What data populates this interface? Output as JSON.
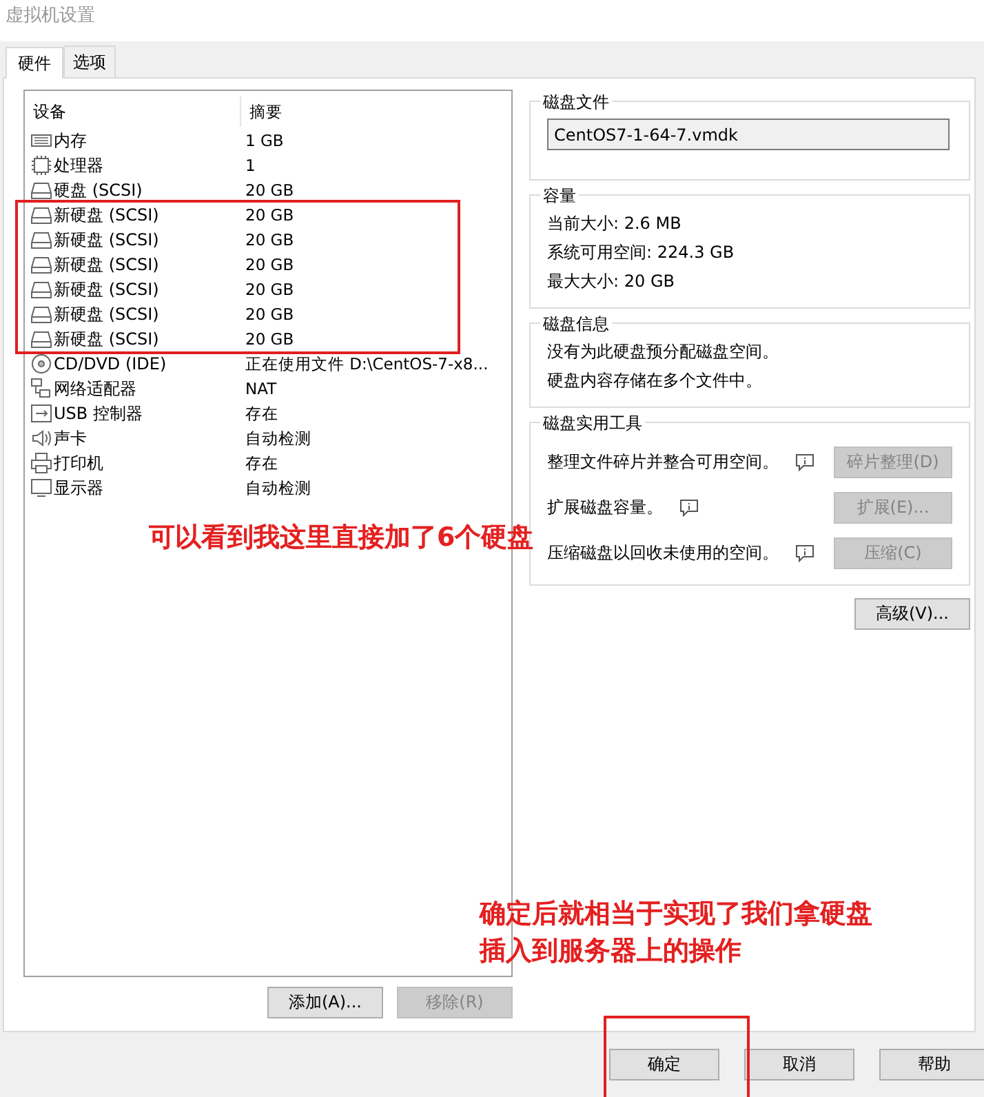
{
  "window": {
    "title": "虚拟机设置"
  },
  "tabs": [
    {
      "label": "硬件",
      "selected": true
    },
    {
      "label": "选项",
      "selected": false
    }
  ],
  "devices": {
    "columns": [
      "设备",
      "摘要"
    ],
    "rows": [
      {
        "kind": "memory",
        "name": "内存",
        "summary": "1 GB"
      },
      {
        "kind": "cpu",
        "name": "处理器",
        "summary": "1"
      },
      {
        "kind": "disk",
        "name": "硬盘 (SCSI)",
        "summary": "20 GB"
      },
      {
        "kind": "disk",
        "name": "新硬盘 (SCSI)",
        "summary": "20 GB"
      },
      {
        "kind": "disk",
        "name": "新硬盘 (SCSI)",
        "summary": "20 GB"
      },
      {
        "kind": "disk",
        "name": "新硬盘 (SCSI)",
        "summary": "20 GB"
      },
      {
        "kind": "disk",
        "name": "新硬盘 (SCSI)",
        "summary": "20 GB"
      },
      {
        "kind": "disk",
        "name": "新硬盘 (SCSI)",
        "summary": "20 GB"
      },
      {
        "kind": "disk",
        "name": "新硬盘 (SCSI)",
        "summary": "20 GB"
      },
      {
        "kind": "cdrom",
        "name": "CD/DVD (IDE)",
        "summary": "正在使用文件 D:\\CentOS-7-x8..."
      },
      {
        "kind": "network",
        "name": "网络适配器",
        "summary": "NAT"
      },
      {
        "kind": "usb",
        "name": "USB 控制器",
        "summary": "存在"
      },
      {
        "kind": "sound",
        "name": "声卡",
        "summary": "自动检测"
      },
      {
        "kind": "printer",
        "name": "打印机",
        "summary": "存在"
      },
      {
        "kind": "display",
        "name": "显示器",
        "summary": "自动检测"
      }
    ]
  },
  "list_buttons": [
    {
      "label": "添加(A)...",
      "disabled": false
    },
    {
      "label": "移除(R)",
      "disabled": true
    }
  ],
  "disk_file": {
    "title": "磁盘文件",
    "value": "CentOS7-1-64-7.vmdk"
  },
  "capacity": {
    "title": "容量",
    "lines": [
      "当前大小: 2.6 MB",
      "系统可用空间: 224.3 GB",
      "最大大小: 20 GB"
    ]
  },
  "disk_info": {
    "title": "磁盘信息",
    "lines": [
      "没有为此硬盘预分配磁盘空间。",
      "硬盘内容存储在多个文件中。"
    ]
  },
  "disk_utilities": {
    "title": "磁盘实用工具",
    "items": [
      {
        "text": "整理文件碎片并整合可用空间。",
        "button": "碎片整理(D)",
        "disabled": true
      },
      {
        "text": "扩展磁盘容量。",
        "button": "扩展(E)...",
        "disabled": true
      },
      {
        "text": "压缩磁盘以回收未使用的空间。",
        "button": "压缩(C)",
        "disabled": true
      }
    ]
  },
  "advanced_button": "高级(V)...",
  "dialog_buttons": [
    {
      "label": "确定"
    },
    {
      "label": "取消"
    },
    {
      "label": "帮助"
    }
  ],
  "annotations": [
    {
      "kind": "rows_box"
    },
    {
      "kind": "ok_box"
    },
    {
      "kind": "note_list",
      "lines": [
        "可以看到我这里直接加了6个硬盘"
      ]
    },
    {
      "kind": "note_ok",
      "lines": [
        "确定后就相当于实现了我们拿硬盘",
        "插入到服务器上的操作"
      ]
    }
  ]
}
